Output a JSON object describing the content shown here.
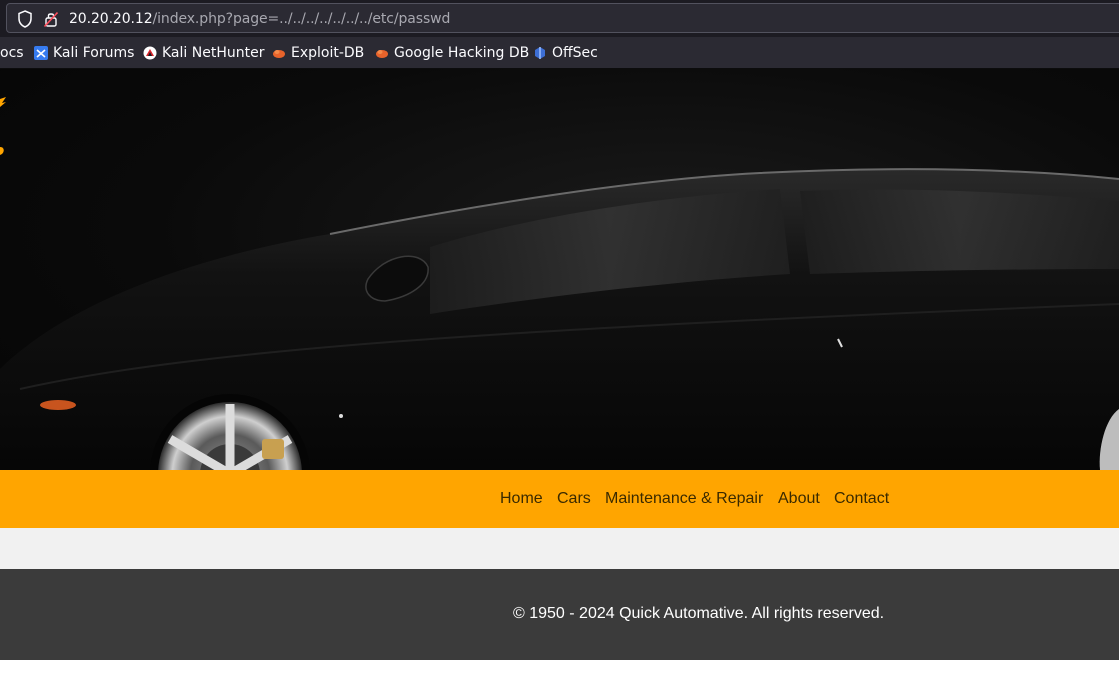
{
  "browser": {
    "url_host": "20.20.20.12",
    "url_path": "/index.php?page=../../../../../../../etc/passwd",
    "bookmarks": [
      {
        "label": "ocs",
        "icon": "bookmark-icon"
      },
      {
        "label": "Kali Forums",
        "icon": "kali-forums-icon"
      },
      {
        "label": "Kali NetHunter",
        "icon": "kali-nethunter-icon"
      },
      {
        "label": "Exploit-DB",
        "icon": "exploit-db-icon"
      },
      {
        "label": "Google Hacking DB",
        "icon": "google-hacking-db-icon"
      },
      {
        "label": "OffSec",
        "icon": "offsec-icon"
      }
    ]
  },
  "hero": {
    "image": "black-sports-car-image",
    "colors": {
      "background": "#0a0a0a",
      "logo_accent": "#ffa500"
    }
  },
  "nav": {
    "items": [
      {
        "label": "Home"
      },
      {
        "label": "Cars"
      },
      {
        "label": "Maintenance & Repair"
      },
      {
        "label": "About"
      },
      {
        "label": "Contact"
      }
    ],
    "colors": {
      "background": "#ffa500"
    }
  },
  "footer": {
    "copyright": "© 1950 - 2024 Quick Automative. All rights reserved.",
    "colors": {
      "background": "#3b3b3b",
      "text": "#ffffff"
    }
  }
}
